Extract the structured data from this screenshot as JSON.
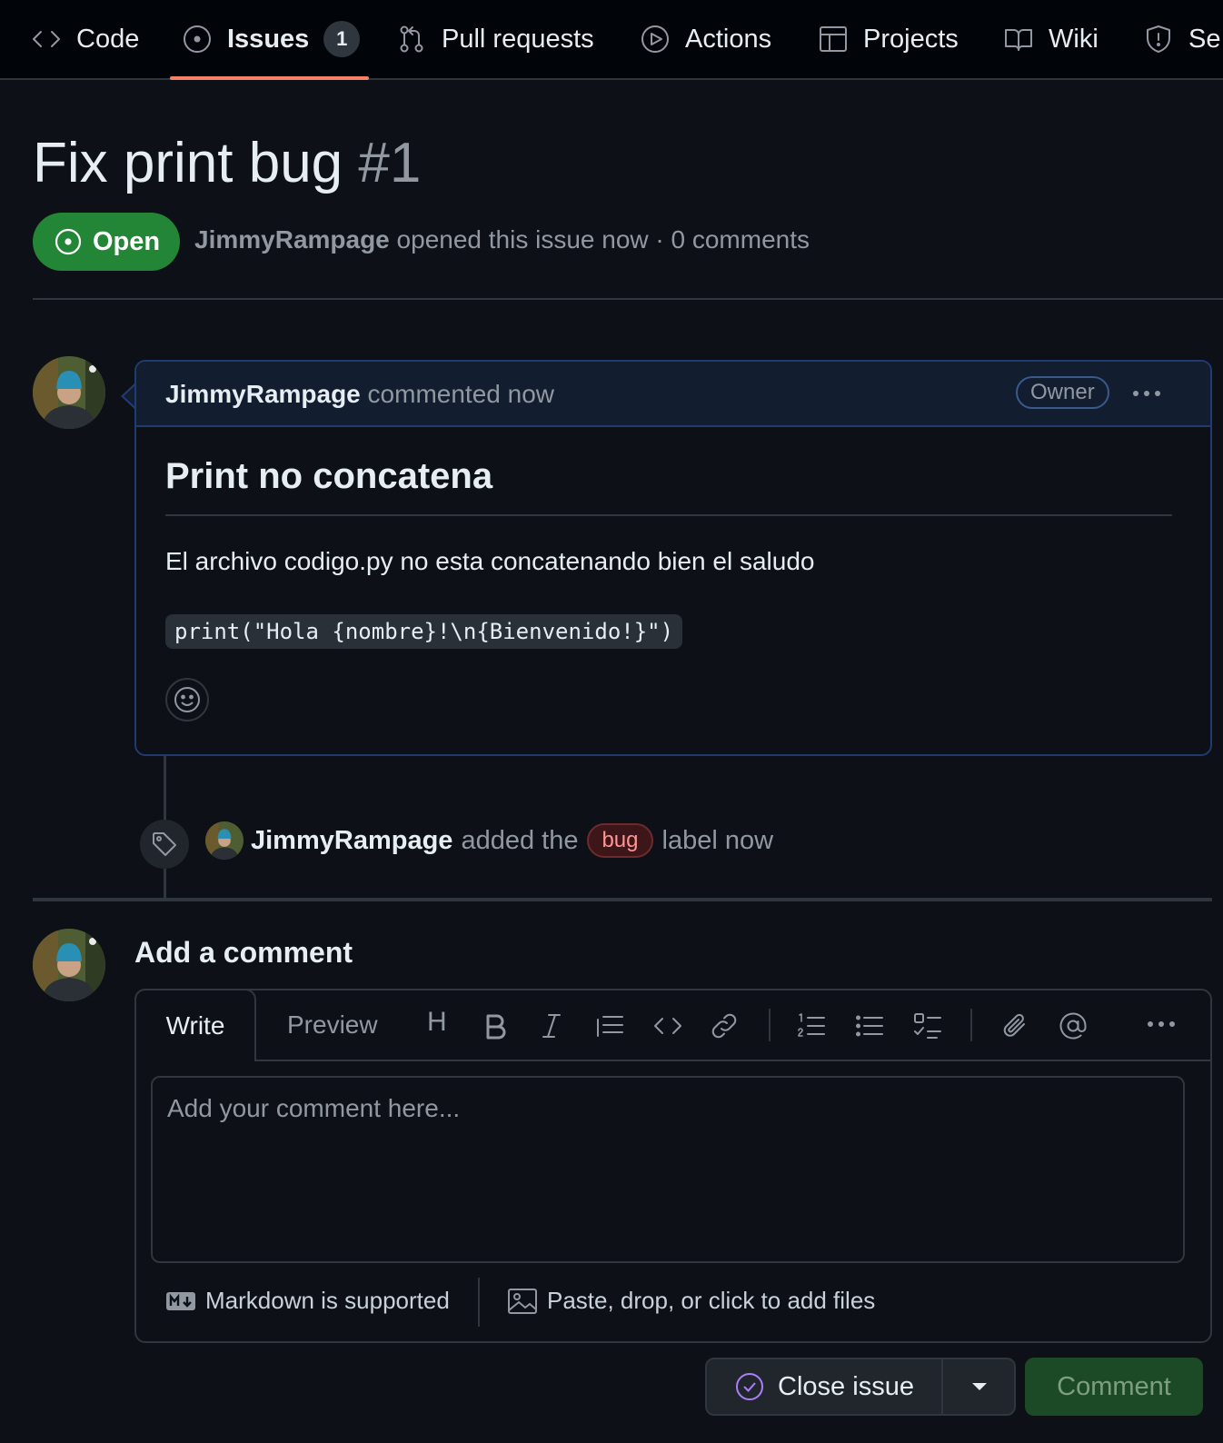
{
  "nav": {
    "tabs": [
      {
        "label": "Code",
        "icon": "code-icon"
      },
      {
        "label": "Issues",
        "icon": "issue-opened-icon",
        "count": "1"
      },
      {
        "label": "Pull requests",
        "icon": "git-pull-request-icon"
      },
      {
        "label": "Actions",
        "icon": "play-icon"
      },
      {
        "label": "Projects",
        "icon": "table-icon"
      },
      {
        "label": "Wiki",
        "icon": "book-icon"
      },
      {
        "label": "Se",
        "icon": "shield-icon"
      }
    ],
    "active": "Issues",
    "accent": "#f78166"
  },
  "issue": {
    "title": "Fix print bug",
    "number": "#1",
    "state": "Open",
    "state_color": "#238636",
    "author": "JimmyRampage",
    "meta_rest": "opened this issue now · 0 comments"
  },
  "comment": {
    "author": "JimmyRampage",
    "action": "commented now",
    "role": "Owner",
    "heading": "Print no concatena",
    "paragraph": "El archivo codigo.py no esta concatenando bien el saludo",
    "code": "print(\"Hola {nombre}!\\n{Bienvenido!}\")"
  },
  "event": {
    "actor": "JimmyRampage",
    "prefix": "added the",
    "label": "bug",
    "suffix": "label now"
  },
  "composer": {
    "title": "Add a comment",
    "write_tab": "Write",
    "preview_tab": "Preview",
    "heading_tool": "H",
    "placeholder": "Add your comment here...",
    "markdown_note": "Markdown is supported",
    "files_note": "Paste, drop, or click to add files",
    "close_button": "Close issue",
    "comment_button": "Comment"
  }
}
